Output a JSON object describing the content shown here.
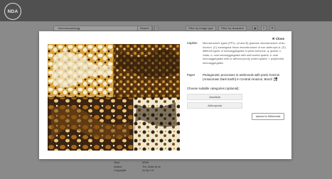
{
  "app": {
    "logo_text": "NDA"
  },
  "search": {
    "value": "micromorphology",
    "button_label": "Search"
  },
  "toolbar": {
    "filter_image_type_label": "Filter by image type",
    "filter_discipline_label": "Filter by discipline"
  },
  "footer": {
    "rows": [
      {
        "key": "Year",
        "value": "2019"
      },
      {
        "key": "Author",
        "value": "Thi, Zotto et al"
      },
      {
        "key": "Copyright",
        "value": "cc-by 2.0"
      }
    ]
  },
  "modal": {
    "close_label": "✖ Close",
    "caption_label": "Caption",
    "caption_text": "Microstructure types (PPL). (A and B) granular microstructure of Au- horizon. (C) subangular block microstructure of non-anthropic A. (D) different types of microaggregates in pedo-horizons. q: quartz; c: voids; o: oval microaggregates with well-sorted quartz; k: oval microaggregates with or without poorly sorted quartz; r: polyhedral microaggregates",
    "paper_label": "Paper",
    "paper_title": "Pedogenetic processes in anthrosols with pretic horizon (Amazonian Dark Earth) in Central Amazon, Brazil",
    "choose_label": "Choose suitable categories (optional):",
    "categories": [
      "Annelida",
      "Arthropoda"
    ],
    "upload_label": "Upload to Wikimedia"
  },
  "colors": {
    "overlay": "#8a8a8a",
    "topbar": "#505050",
    "modal_bg": "#ffffff",
    "micrograph_dark": "#2a1a0a",
    "micrograph_amber": "#b5720f",
    "micrograph_light": "#f5eecf"
  }
}
